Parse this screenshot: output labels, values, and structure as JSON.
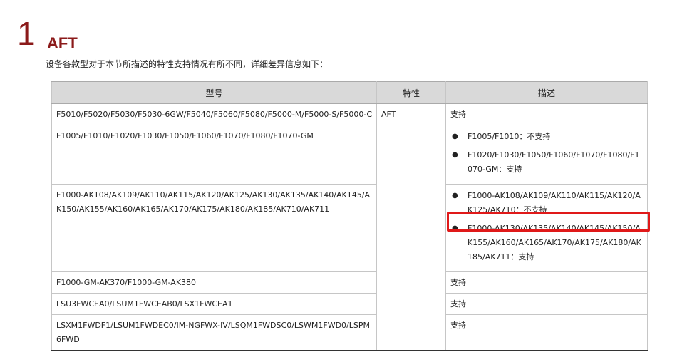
{
  "section": {
    "number": "1",
    "title": "AFT",
    "intro": "设备各款型对于本节所描述的特性支持情况有所不同，详细差异信息如下："
  },
  "table": {
    "headers": {
      "model": "型号",
      "feature": "特性",
      "description": "描述"
    },
    "feature_value": "AFT",
    "rows": [
      {
        "model": "F5010/F5020/F5030/F5030-6GW/F5040/F5060/F5080/F5000-M/F5000-S/F5000-C",
        "description": "支持"
      },
      {
        "model": "F1005/F1010/F1020/F1030/F1050/F1060/F1070/F1080/F1070-GM",
        "items": [
          "F1005/F1010：不支持",
          "F1020/F1030/F1050/F1060/F1070/F1080/F1070-GM：支持"
        ]
      },
      {
        "model": "F1000-AK108/AK109/AK110/AK115/AK120/AK125/AK130/AK135/AK140/AK145/AK150/AK155/AK160/AK165/AK170/AK175/AK180/AK185/AK710/AK711",
        "items": [
          "F1000-AK108/AK109/AK110/AK115/AK120/AK125/AK710：不支持",
          "F1000-AK130/AK135/AK140/AK145/AK150/AK155/AK160/AK165/AK170/AK175/AK180/AK185/AK711：支持"
        ]
      },
      {
        "model": "F1000-GM-AK370/F1000-GM-AK380",
        "description": "支持"
      },
      {
        "model": "LSU3FWCEA0/LSUM1FWCEAB0/LSX1FWCEA1",
        "description": "支持"
      },
      {
        "model": "LSXM1FWDF1/LSUM1FWDEC0/IM-NGFWX-IV/LSQM1FWDSC0/LSWM1FWD0/LSPM6FWD",
        "description": "支持"
      }
    ]
  },
  "highlight_color": "#e01919",
  "title_color": "#8b1a1a",
  "header_bg": "#d9d9d9"
}
